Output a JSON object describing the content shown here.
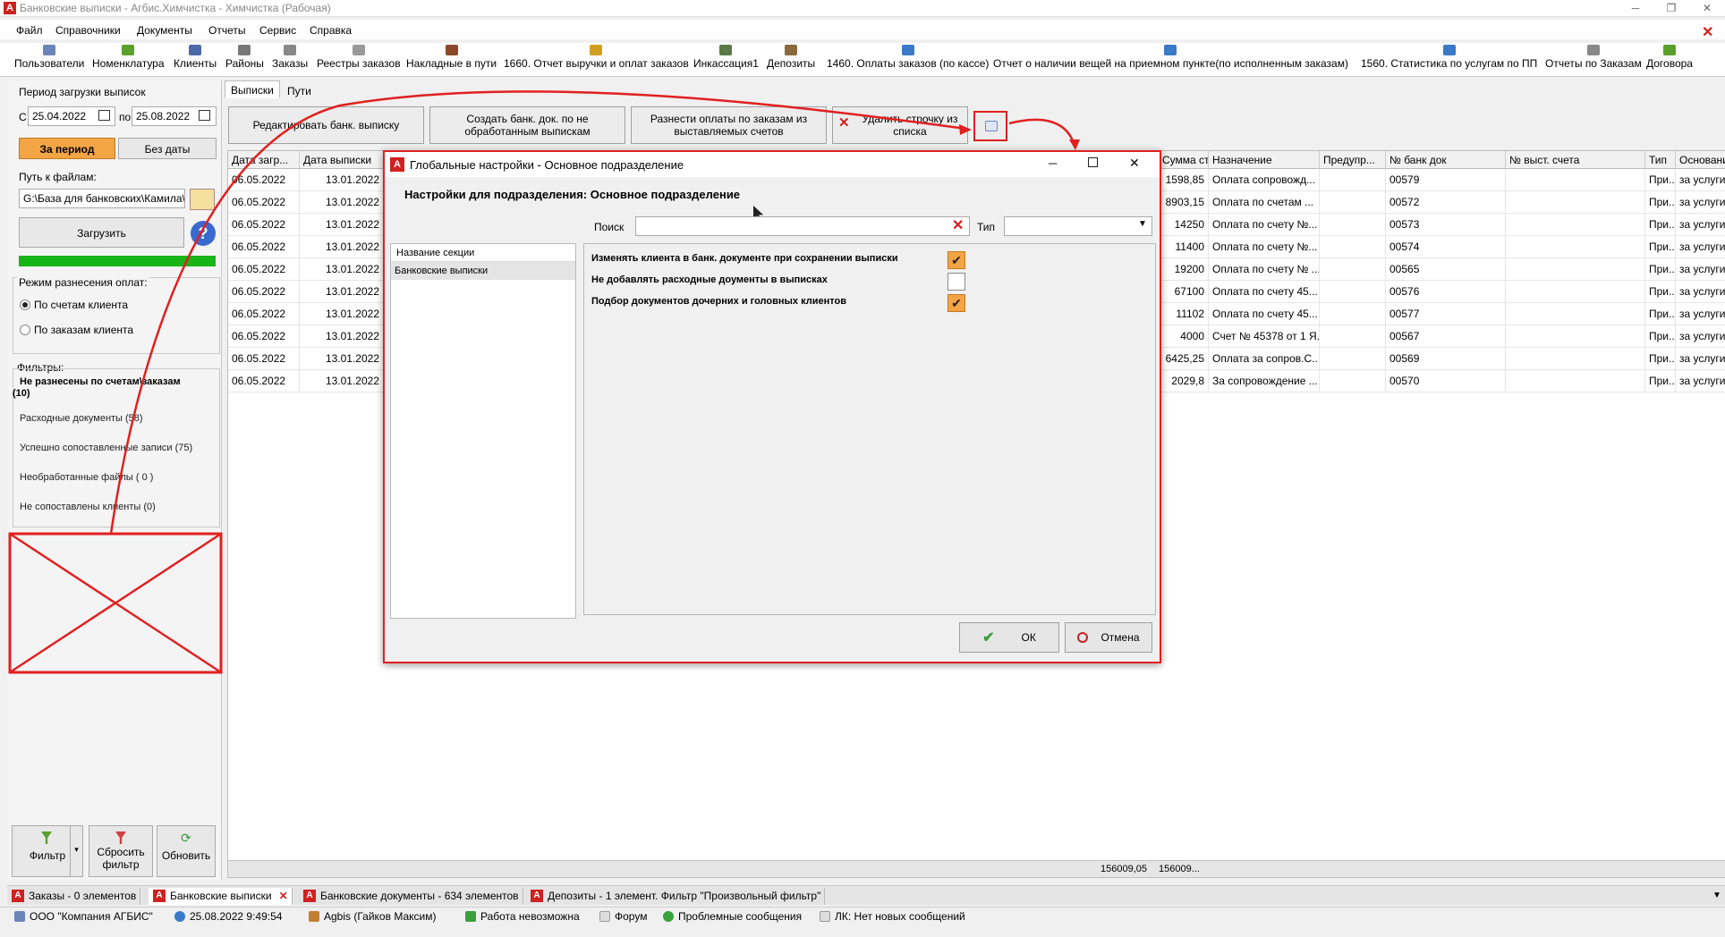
{
  "window": {
    "title": "Банковские выписки - Агбис.Химчистка - Химчистка (Рабочая)",
    "logo_letter": "A"
  },
  "menu": [
    "Файл",
    "Справочники",
    "Документы",
    "Отчеты",
    "Сервис",
    "Справка"
  ],
  "toolbar": [
    {
      "label": "Пользователи",
      "icon": "users-icon",
      "color": "#6a86b8"
    },
    {
      "label": "Номенклатура",
      "icon": "nomenclature-icon",
      "color": "#5aa02c"
    },
    {
      "label": "Клиенты",
      "icon": "clients-icon",
      "color": "#4a6aa8"
    },
    {
      "label": "Районы",
      "icon": "districts-icon",
      "color": "#777777"
    },
    {
      "label": "Заказы",
      "icon": "orders-icon",
      "color": "#888888"
    },
    {
      "label": "Реестры заказов",
      "icon": "registers-icon",
      "color": "#999999"
    },
    {
      "label": "Накладные в пути",
      "icon": "waybills-icon",
      "color": "#8a4a2a"
    },
    {
      "label": "1660. Отчет выручки и оплат заказов",
      "icon": "report-icon",
      "color": "#d0a020"
    },
    {
      "label": "Инкассация1",
      "icon": "collection-icon",
      "color": "#5a7a4a"
    },
    {
      "label": "Депозиты",
      "icon": "deposits-icon",
      "color": "#8a6a3a"
    },
    {
      "label": "1460. Оплаты заказов (по кассе)",
      "icon": "payments-icon",
      "color": "#3a7ac8"
    },
    {
      "label": "Отчет о наличии вещей на приемном пункте(по исполненным заказам)",
      "icon": "items-report-icon",
      "color": "#3a7ac8"
    },
    {
      "label": "1560. Статистика по услугам по ПП",
      "icon": "stats-icon",
      "color": "#3a7ac8"
    },
    {
      "label": "Отчеты по Заказам",
      "icon": "order-reports-icon",
      "color": "#888888"
    },
    {
      "label": "Договора",
      "icon": "contracts-icon",
      "color": "#5aa02c"
    }
  ],
  "left": {
    "period_label": "Период загрузки выписок",
    "from_label": "С",
    "from_date": "25.04.2022",
    "to_label": "по",
    "to_date": "25.08.2022",
    "btn_period": "За период",
    "btn_nodate": "Без даты",
    "path_label": "Путь к файлам:",
    "path_value": "G:\\База для банковских\\Камила\\",
    "btn_load": "Загрузить",
    "mode_label": "Режим разнесения оплат:",
    "mode_clients": "По счетам клиента",
    "mode_orders": "По заказам клиента",
    "filters_label": "Фильтры:",
    "filter_main_line1": "Не разнесены по счетам\\заказам",
    "filter_main_line2": "(10)",
    "filters": [
      "Расходные документы (58)",
      "Успешно сопоставленные записи (75)",
      "Необработанные файлы ( 0 )",
      "Не сопоставлены клиенты (0)"
    ],
    "btn_filter": "Фильтр",
    "btn_reset_line1": "Сбросить",
    "btn_reset_line2": "фильтр",
    "btn_refresh": "Обновить"
  },
  "tabs": [
    "Выписки",
    "Пути"
  ],
  "actions": {
    "edit_statement": "Редактировать банк. выписку",
    "create_doc_line1": "Создать банк. док. по не",
    "create_doc_line2": "обработанным выпискам",
    "spread_line1": "Разнести оплаты по заказам из",
    "spread_line2": "выставляемых счетов",
    "delete_line1": "Удалить строчку из",
    "delete_line2": "списка"
  },
  "grid": {
    "headers_left": [
      "Дата загр...",
      "Дата выписки"
    ],
    "headers_right": [
      "Сумма ст. с...",
      "Назначение",
      "Предупр...",
      "№ банк док",
      "№ выст. счета",
      "Тип",
      "Основание"
    ],
    "rows": [
      {
        "load": "06.05.2022",
        "stmt": "13.01.2022",
        "sum": "1598,85",
        "purpose": "Оплата сопровожд...",
        "doc": "00579",
        "type": "При...",
        "base": "за услуги"
      },
      {
        "load": "06.05.2022",
        "stmt": "13.01.2022",
        "sum": "8903,15",
        "purpose": "Оплата по счетам ...",
        "doc": "00572",
        "type": "При...",
        "base": "за услуги"
      },
      {
        "load": "06.05.2022",
        "stmt": "13.01.2022",
        "sum": "14250",
        "purpose": "Оплата по счету №...",
        "doc": "00573",
        "type": "При...",
        "base": "за услуги"
      },
      {
        "load": "06.05.2022",
        "stmt": "13.01.2022",
        "sum": "11400",
        "purpose": "Оплата по счету №...",
        "doc": "00574",
        "type": "При...",
        "base": "за услуги"
      },
      {
        "load": "06.05.2022",
        "stmt": "13.01.2022",
        "sum": "19200",
        "purpose": "Оплата по счету № ...",
        "doc": "00565",
        "type": "При...",
        "base": "за услуги"
      },
      {
        "load": "06.05.2022",
        "stmt": "13.01.2022",
        "sum": "67100",
        "purpose": "Оплата по счету 45...",
        "doc": "00576",
        "type": "При...",
        "base": "за услуги"
      },
      {
        "load": "06.05.2022",
        "stmt": "13.01.2022",
        "sum": "11102",
        "purpose": "Оплата по счету 45...",
        "doc": "00577",
        "type": "При...",
        "base": "за услуги"
      },
      {
        "load": "06.05.2022",
        "stmt": "13.01.2022",
        "sum": "4000",
        "purpose": "Счет № 45378 от 1 Я...",
        "doc": "00567",
        "type": "При...",
        "base": "за услуги"
      },
      {
        "load": "06.05.2022",
        "stmt": "13.01.2022",
        "sum": "6425,25",
        "purpose": "Оплата за сопров.С...",
        "doc": "00569",
        "type": "При...",
        "base": "за услуги"
      },
      {
        "load": "06.05.2022",
        "stmt": "13.01.2022",
        "sum": "2029,8",
        "purpose": "За сопровождение ...",
        "doc": "00570",
        "type": "При...",
        "base": "за услуги"
      }
    ],
    "sum_a": "156009,05",
    "sum_b": "156009..."
  },
  "dialog": {
    "title": "Глобальные настройки - Основное подразделение",
    "heading": "Настройки для подразделения: Основное подразделение",
    "search_label": "Поиск",
    "search_value": "",
    "type_label": "Тип",
    "type_value": "",
    "sections_header": "Название секции",
    "sections": [
      "Банковские выписки"
    ],
    "settings": [
      {
        "label": "Изменять клиента в банк. документе при сохранении выписки",
        "checked": true
      },
      {
        "label": "Не добавлять расходные доументы в выписках",
        "checked": false
      },
      {
        "label": "Подбор документов дочерних и головных клиентов",
        "checked": true
      }
    ],
    "ok": "ОК",
    "cancel": "Отмена"
  },
  "doc_tabs": [
    "Заказы - 0 элементов",
    "Банковские выписки",
    "Банковские документы - 634 элементов",
    "Депозиты - 1 элемент. Фильтр \"Произвольный фильтр\""
  ],
  "status": {
    "company": "ООО \"Компания АГБИС\"",
    "datetime": "25.08.2022 9:49:54",
    "user": "Agbis (Гайков Максим)",
    "work": "Работа невозможна",
    "forum": "Форум",
    "problems": "Проблемные сообщения",
    "lk": "ЛК: Нет новых сообщений"
  },
  "colors": {
    "accent_orange": "#f3a546",
    "progress_green": "#18b418",
    "annotation_red": "#e02020",
    "brand_red": "#d02020"
  }
}
